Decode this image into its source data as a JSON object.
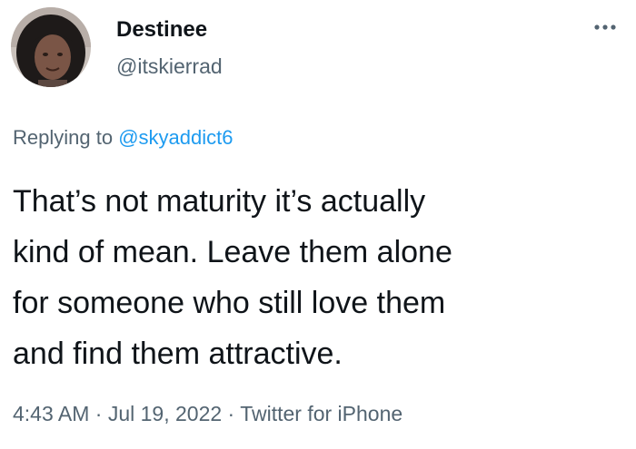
{
  "author": {
    "display_name": "Destinee",
    "handle": "@itskierrad",
    "avatar_icon": "profile-photo"
  },
  "menu": {
    "icon": "more-horizontal-icon"
  },
  "reply": {
    "prefix": "Replying to ",
    "mention": "@skyaddict6"
  },
  "tweet": {
    "lines": [
      "That’s not maturity it’s actually",
      "kind of mean. Leave them alone",
      "for someone who still love them",
      "and find them attractive."
    ]
  },
  "meta": {
    "time": "4:43 AM",
    "separator": " · ",
    "date": "Jul 19, 2022",
    "source": "Twitter for iPhone"
  },
  "colors": {
    "text": "#0f1419",
    "secondary": "#536471",
    "accent": "#1d9bf0"
  }
}
